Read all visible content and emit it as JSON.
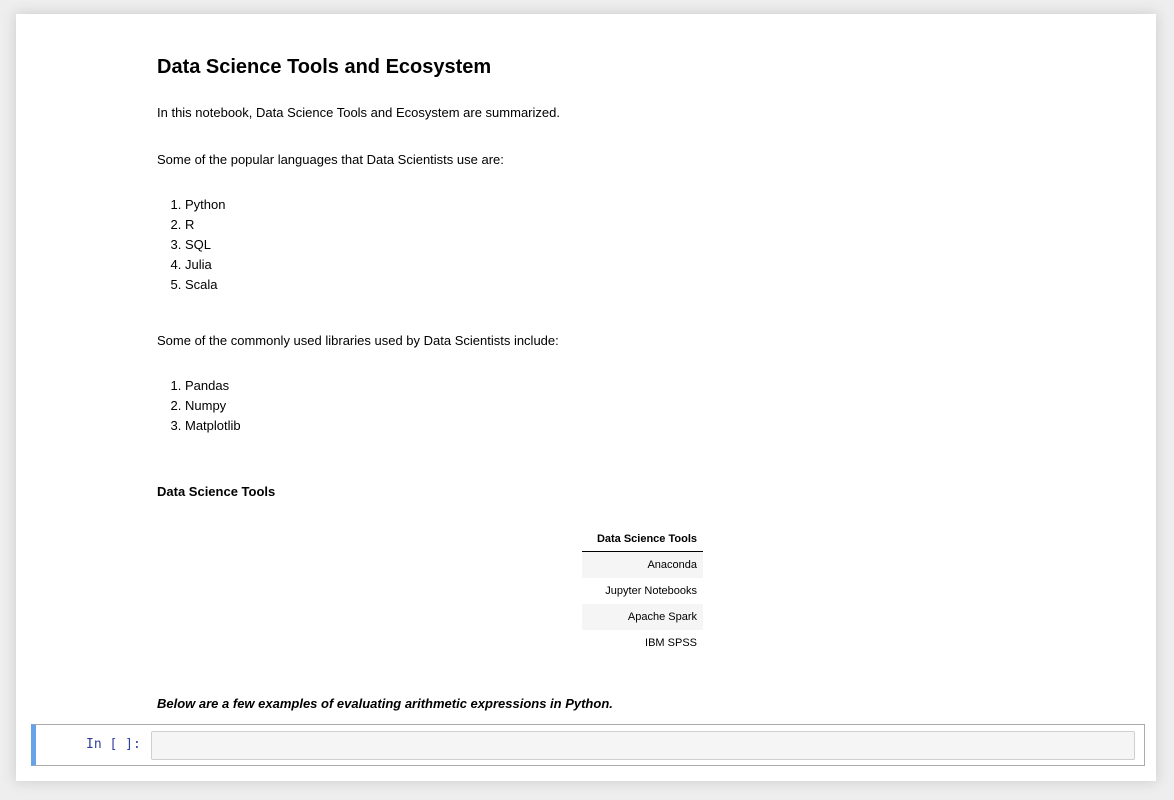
{
  "title": "Data Science Tools and Ecosystem",
  "intro": "In this notebook, Data Science Tools and Ecosystem are summarized.",
  "languages_intro": "Some of the popular languages that Data Scientists use are:",
  "languages": [
    "Python",
    "R",
    "SQL",
    "Julia",
    "Scala"
  ],
  "libraries_intro": "Some of the commonly used libraries used by Data Scientists include:",
  "libraries": [
    "Pandas",
    "Numpy",
    "Matplotlib"
  ],
  "tools_heading": "Data Science Tools",
  "tools_table": {
    "header": "Data Science Tools",
    "rows": [
      "Anaconda",
      "Jupyter Notebooks",
      "Apache Spark",
      "IBM SPSS"
    ]
  },
  "arith_note": "Below are a few examples of evaluating arithmetic expressions in Python.",
  "code_cell": {
    "prompt": "In [ ]:",
    "value": ""
  }
}
